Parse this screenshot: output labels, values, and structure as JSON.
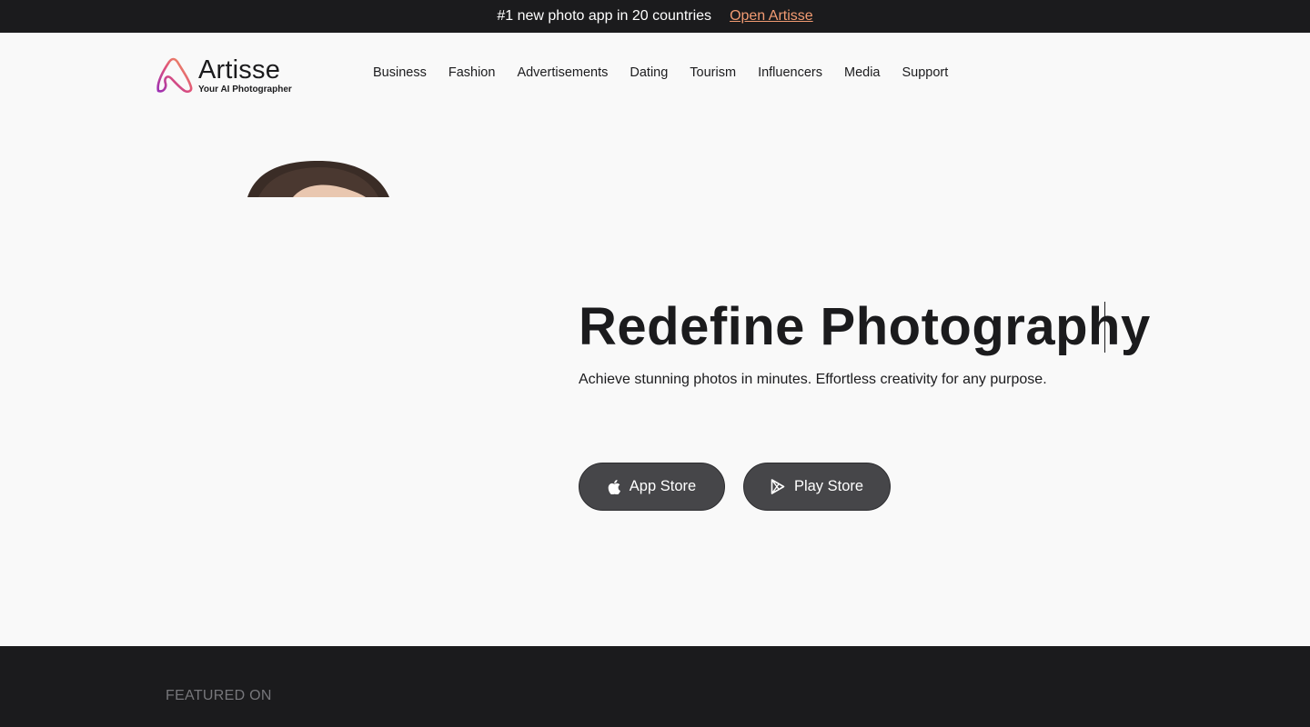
{
  "announcement": {
    "text": "#1 new photo app in 20 countries",
    "link_label": "Open Artisse"
  },
  "brand": {
    "name": "Artisse",
    "tagline": "Your AI Photographer",
    "icon": "artisse-logo-icon"
  },
  "nav": {
    "items": [
      {
        "label": "Business"
      },
      {
        "label": "Fashion"
      },
      {
        "label": "Advertisements"
      },
      {
        "label": "Dating"
      },
      {
        "label": "Tourism"
      },
      {
        "label": "Influencers"
      },
      {
        "label": "Media"
      },
      {
        "label": "Support"
      }
    ]
  },
  "hero": {
    "title": "Redefine Photography",
    "subtitle": "Achieve stunning photos in minutes. Effortless creativity for any purpose.",
    "buttons": {
      "app_store": {
        "label": "App Store",
        "icon": "apple-icon"
      },
      "play_store": {
        "label": "Play Store",
        "icon": "play-store-icon"
      }
    }
  },
  "featured": {
    "label": "FEATURED ON"
  },
  "colors": {
    "dark": "#1b1b1d",
    "accent_link": "#f29b72",
    "button_bg": "#464649",
    "page_bg": "#f9f9f9"
  }
}
